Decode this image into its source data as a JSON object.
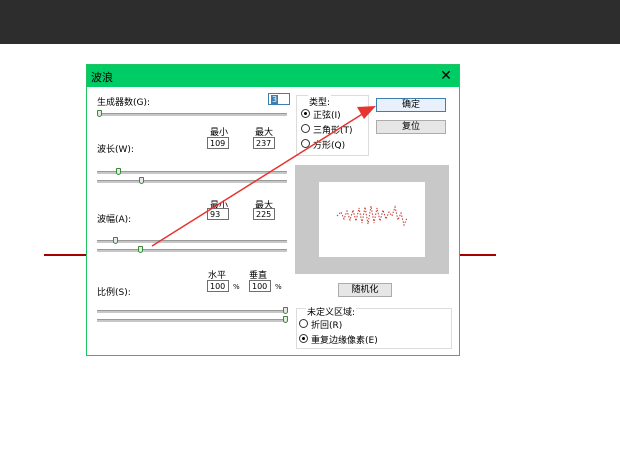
{
  "dialog": {
    "title": "波浪",
    "close_glyph": "✕"
  },
  "generators": {
    "label": "生成器数(G):",
    "value": "3"
  },
  "wavelength": {
    "label": "波长(W):",
    "min_label": "最小",
    "max_label": "最大",
    "min": "109",
    "max": "237"
  },
  "amplitude": {
    "label": "波幅(A):",
    "min_label": "最小",
    "max_label": "最大",
    "min": "93",
    "max": "225"
  },
  "scale": {
    "label": "比例(S):",
    "h_label": "水平",
    "v_label": "垂直",
    "h": "100",
    "v": "100",
    "unit": "%"
  },
  "type": {
    "label": "类型:",
    "options": [
      {
        "label": "正弦(I)",
        "selected": true
      },
      {
        "label": "三角形(T)",
        "selected": false
      },
      {
        "label": "方形(Q)",
        "selected": false
      }
    ]
  },
  "buttons": {
    "ok": "确定",
    "reset": "复位",
    "randomize": "随机化"
  },
  "undefined_area": {
    "label": "未定义区域:",
    "options": [
      {
        "label": "折回(R)",
        "selected": false
      },
      {
        "label": "重复边缘像素(E)",
        "selected": true
      }
    ]
  },
  "colors": {
    "accent": "#00cc66",
    "annotation_arrow": "#e8342f",
    "background_line": "#a80000",
    "top_bar": "#2d2d2d"
  }
}
